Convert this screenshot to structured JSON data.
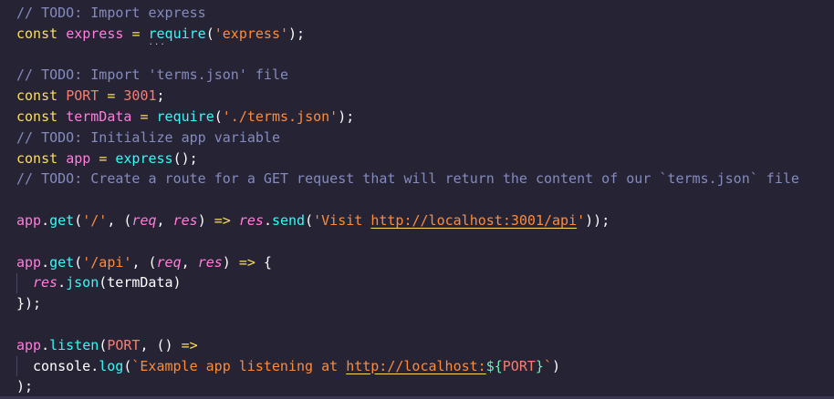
{
  "editor": {
    "lines": [
      {
        "tokens": [
          {
            "c": "c",
            "t": "// TODO: Import express"
          }
        ]
      },
      {
        "tokens": [
          {
            "c": "k",
            "t": "const"
          },
          {
            "c": "p",
            "t": " "
          },
          {
            "c": "v",
            "t": "express"
          },
          {
            "c": "p",
            "t": " "
          },
          {
            "c": "o",
            "t": "="
          },
          {
            "c": "p",
            "t": " "
          },
          {
            "c": "f squig",
            "t": "require"
          },
          {
            "c": "p",
            "t": "("
          },
          {
            "c": "s",
            "t": "'express'"
          },
          {
            "c": "p",
            "t": ");"
          }
        ]
      },
      {
        "tokens": []
      },
      {
        "tokens": [
          {
            "c": "c",
            "t": "// TODO: Import 'terms.json' file"
          }
        ]
      },
      {
        "tokens": [
          {
            "c": "k",
            "t": "const"
          },
          {
            "c": "p",
            "t": " "
          },
          {
            "c": "n",
            "t": "PORT"
          },
          {
            "c": "p",
            "t": " "
          },
          {
            "c": "o",
            "t": "="
          },
          {
            "c": "p",
            "t": " "
          },
          {
            "c": "n",
            "t": "3001"
          },
          {
            "c": "p",
            "t": ";"
          }
        ]
      },
      {
        "tokens": [
          {
            "c": "k",
            "t": "const"
          },
          {
            "c": "p",
            "t": " "
          },
          {
            "c": "v",
            "t": "termData"
          },
          {
            "c": "p",
            "t": " "
          },
          {
            "c": "o",
            "t": "="
          },
          {
            "c": "p",
            "t": " "
          },
          {
            "c": "f",
            "t": "require"
          },
          {
            "c": "p",
            "t": "("
          },
          {
            "c": "s",
            "t": "'./terms.json'"
          },
          {
            "c": "p",
            "t": ");"
          }
        ]
      },
      {
        "tokens": [
          {
            "c": "c",
            "t": "// TODO: Initialize app variable"
          }
        ]
      },
      {
        "tokens": [
          {
            "c": "k",
            "t": "const"
          },
          {
            "c": "p",
            "t": " "
          },
          {
            "c": "v",
            "t": "app"
          },
          {
            "c": "p",
            "t": " "
          },
          {
            "c": "o",
            "t": "="
          },
          {
            "c": "p",
            "t": " "
          },
          {
            "c": "f",
            "t": "express"
          },
          {
            "c": "p",
            "t": "();"
          }
        ]
      },
      {
        "tokens": [
          {
            "c": "c",
            "t": "// TODO: Create a route for a GET request that will return the content of our `terms.json` file"
          }
        ]
      },
      {
        "tokens": []
      },
      {
        "tokens": [
          {
            "c": "v",
            "t": "app"
          },
          {
            "c": "p",
            "t": "."
          },
          {
            "c": "f",
            "t": "get"
          },
          {
            "c": "p",
            "t": "("
          },
          {
            "c": "s",
            "t": "'/'"
          },
          {
            "c": "p",
            "t": ", ("
          },
          {
            "c": "pa",
            "t": "req"
          },
          {
            "c": "p",
            "t": ", "
          },
          {
            "c": "pa",
            "t": "res"
          },
          {
            "c": "p",
            "t": ") "
          },
          {
            "c": "o",
            "t": "=>"
          },
          {
            "c": "p",
            "t": " "
          },
          {
            "c": "pa",
            "t": "res"
          },
          {
            "c": "p",
            "t": "."
          },
          {
            "c": "f",
            "t": "send"
          },
          {
            "c": "p",
            "t": "("
          },
          {
            "c": "s",
            "t": "'Visit "
          },
          {
            "c": "s link",
            "t": "http://localhost:3001/api"
          },
          {
            "c": "s",
            "t": "'"
          },
          {
            "c": "p",
            "t": "));"
          }
        ]
      },
      {
        "tokens": []
      },
      {
        "tokens": [
          {
            "c": "v",
            "t": "app"
          },
          {
            "c": "p",
            "t": "."
          },
          {
            "c": "f",
            "t": "get"
          },
          {
            "c": "p",
            "t": "("
          },
          {
            "c": "s",
            "t": "'/api'"
          },
          {
            "c": "p",
            "t": ", ("
          },
          {
            "c": "pa",
            "t": "req"
          },
          {
            "c": "p",
            "t": ", "
          },
          {
            "c": "pa",
            "t": "res"
          },
          {
            "c": "p",
            "t": ") "
          },
          {
            "c": "o",
            "t": "=>"
          },
          {
            "c": "p",
            "t": " {"
          }
        ]
      },
      {
        "indent": 1,
        "tokens": [
          {
            "c": "pa",
            "t": "res"
          },
          {
            "c": "p",
            "t": "."
          },
          {
            "c": "f",
            "t": "json"
          },
          {
            "c": "p",
            "t": "(termData)"
          }
        ]
      },
      {
        "tokens": [
          {
            "c": "p",
            "t": "});"
          }
        ]
      },
      {
        "tokens": []
      },
      {
        "tokens": [
          {
            "c": "v",
            "t": "app"
          },
          {
            "c": "p",
            "t": "."
          },
          {
            "c": "f",
            "t": "listen"
          },
          {
            "c": "p",
            "t": "("
          },
          {
            "c": "n",
            "t": "PORT"
          },
          {
            "c": "p",
            "t": ", () "
          },
          {
            "c": "o",
            "t": "=>"
          }
        ]
      },
      {
        "indent": 1,
        "tokens": [
          {
            "c": "p",
            "t": "console"
          },
          {
            "c": "p",
            "t": "."
          },
          {
            "c": "f",
            "t": "log"
          },
          {
            "c": "p",
            "t": "("
          },
          {
            "c": "s",
            "t": "`Example app listening at "
          },
          {
            "c": "s link",
            "t": "http://localhost:"
          },
          {
            "c": "t",
            "t": "${"
          },
          {
            "c": "n",
            "t": "PORT"
          },
          {
            "c": "t",
            "t": "}"
          },
          {
            "c": "s",
            "t": "`"
          },
          {
            "c": "p",
            "t": ")"
          }
        ]
      },
      {
        "tokens": [
          {
            "c": "p",
            "t": ");"
          }
        ]
      }
    ]
  }
}
